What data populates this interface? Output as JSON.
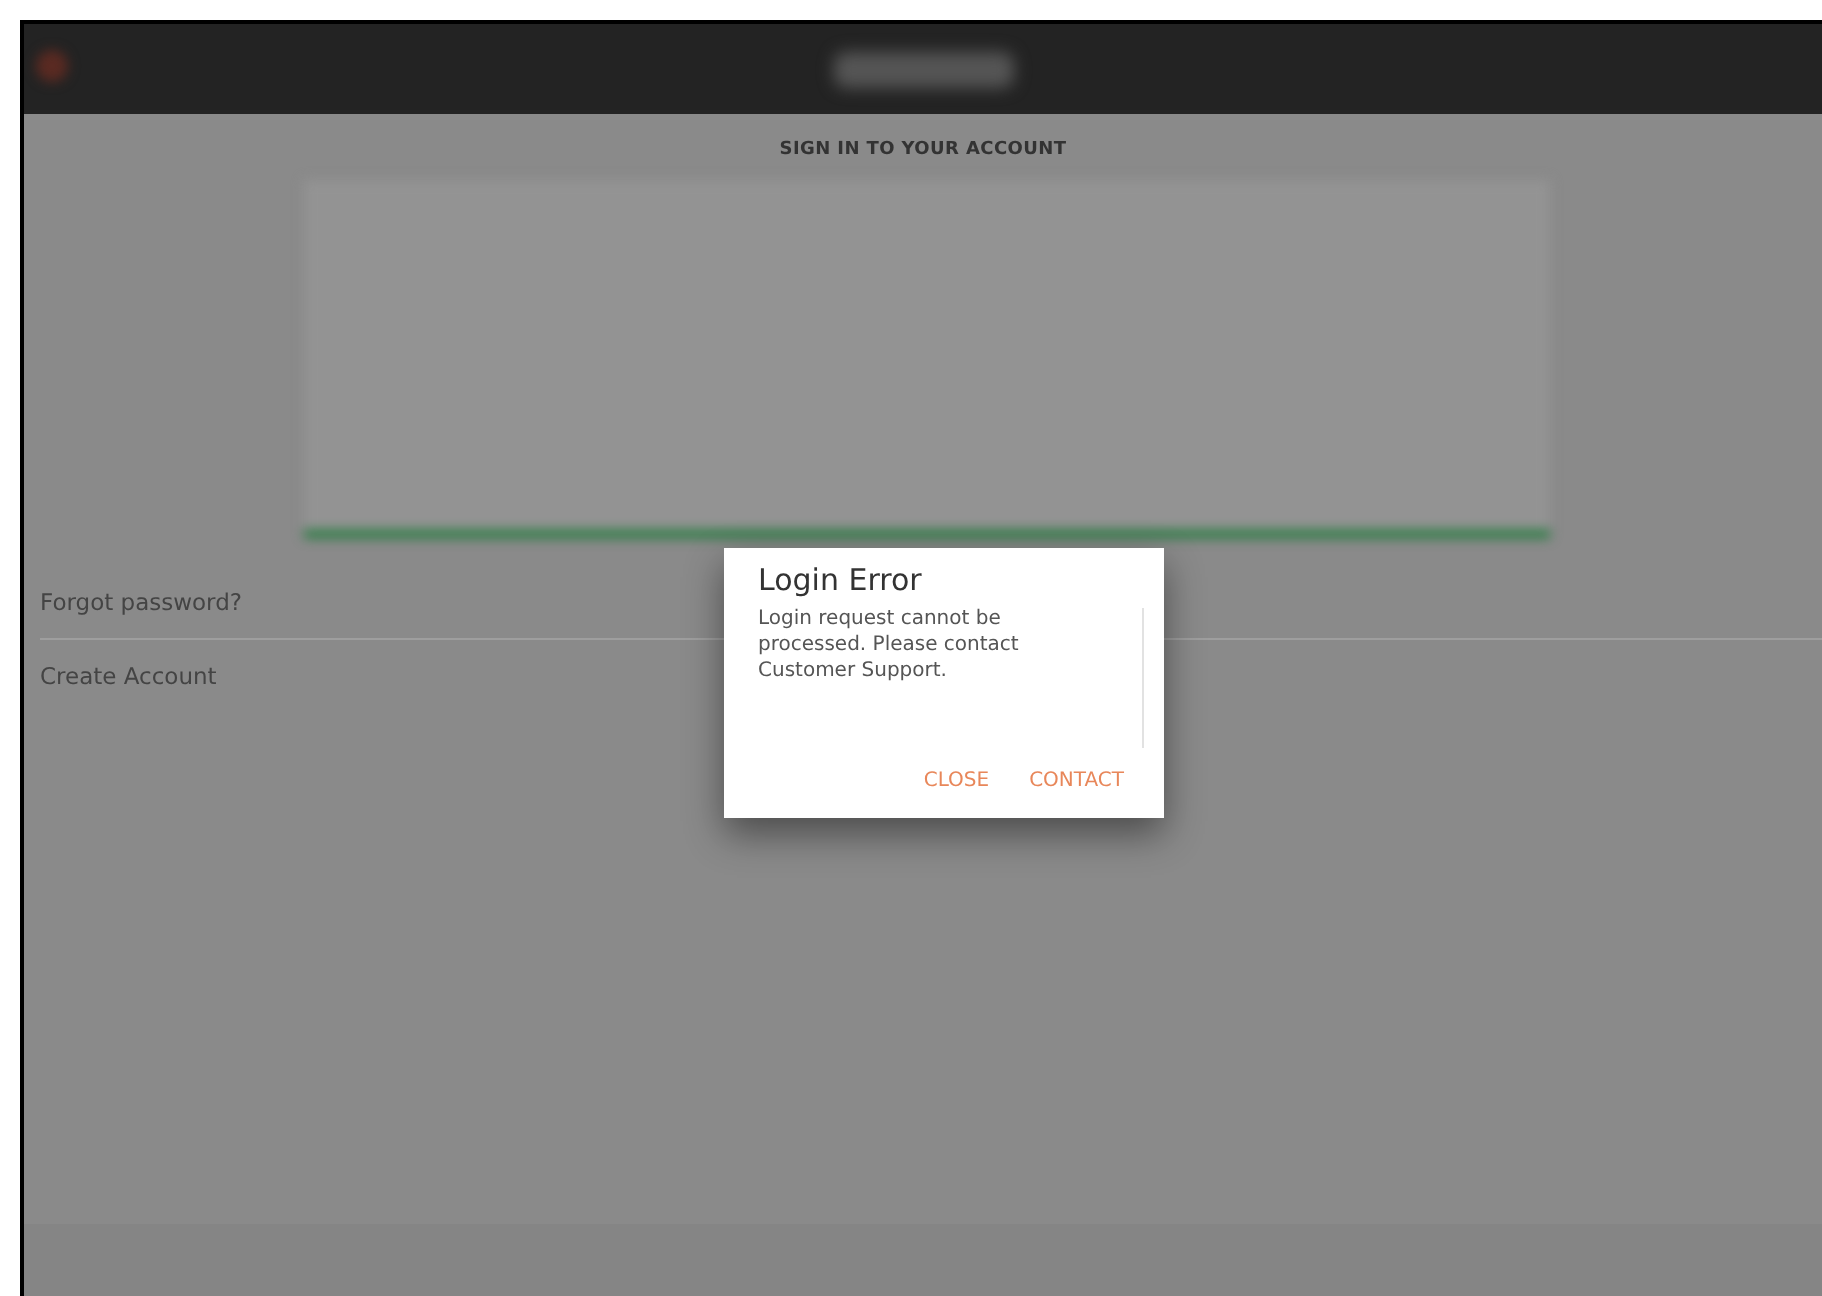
{
  "screen": {
    "heading": "SIGN IN TO YOUR ACCOUNT"
  },
  "links": [
    {
      "label": "Forgot password?"
    },
    {
      "label": "Create Account"
    }
  ],
  "dialog": {
    "title": "Login Error",
    "message": "Login request cannot be processed. Please contact Customer Support.",
    "actions": [
      {
        "label": "CLOSE"
      },
      {
        "label": "CONTACT"
      }
    ]
  }
}
